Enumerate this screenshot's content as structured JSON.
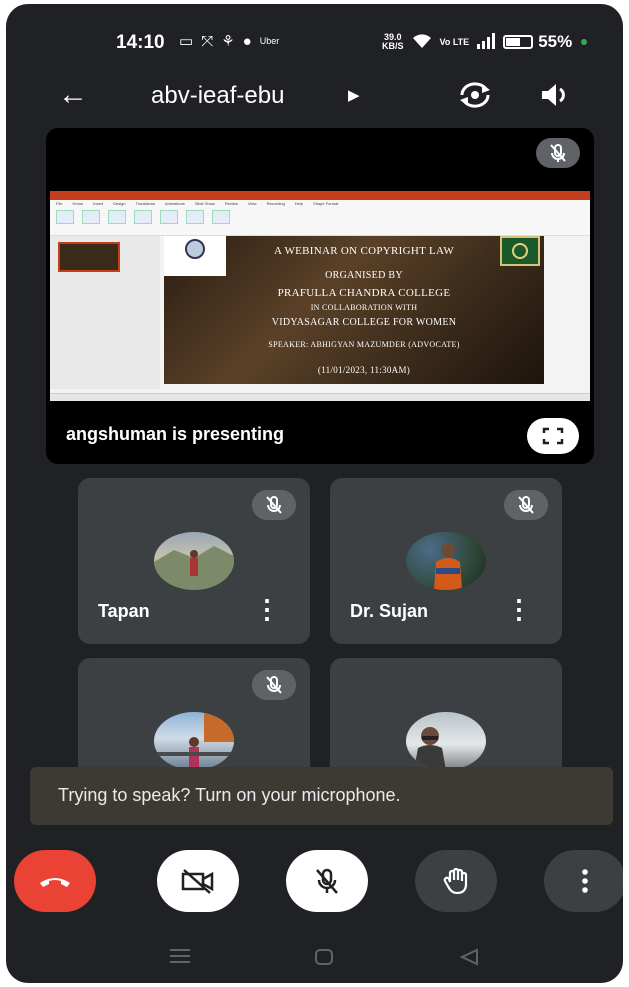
{
  "status_bar": {
    "time": "14:10",
    "carrier_badge": "Uber",
    "net_speed_value": "39.0",
    "net_speed_unit": "KB/S",
    "volte": "Vo LTE",
    "battery": "55%"
  },
  "header": {
    "meeting_code": "abv-ieaf-ebu"
  },
  "presentation": {
    "caption": "angshuman is presenting",
    "slide": {
      "line1": "A WEBINAR ON COPYRIGHT LAW",
      "line2": "ORGANISED BY",
      "line3": "PRAFULLA CHANDRA COLLEGE",
      "line4": "IN COLLABORATION WITH",
      "line5": "VIDYASAGAR COLLEGE FOR WOMEN",
      "line6": "SPEAKER: ABHIGYAN MAZUMDER (ADVOCATE)",
      "line7": "(11/01/2023, 11:30AM)"
    },
    "ribbon_tabs": [
      "File",
      "Home",
      "Insert",
      "Design",
      "Transitions",
      "Animations",
      "Slide Show",
      "Review",
      "View",
      "Recording",
      "Help",
      "Shape Format"
    ]
  },
  "participants": [
    {
      "name": "Tapan",
      "muted": true
    },
    {
      "name": "Dr. Sujan",
      "muted": true
    },
    {
      "name": "",
      "muted": true
    },
    {
      "name": "",
      "muted": false
    }
  ],
  "toast": {
    "message": "Trying to speak? Turn on your microphone."
  },
  "colors": {
    "background": "#202124",
    "tile": "#3c4043",
    "end_call": "#ea4335",
    "control_light": "#ffffff",
    "control_dark": "#3c4043"
  },
  "controls": [
    {
      "name": "end-call",
      "icon": "phone-hangup-icon"
    },
    {
      "name": "camera-off",
      "icon": "video-off-icon"
    },
    {
      "name": "mic-off",
      "icon": "mic-off-icon"
    },
    {
      "name": "raise-hand",
      "icon": "hand-icon"
    },
    {
      "name": "more-options",
      "icon": "more-vert-icon"
    }
  ]
}
